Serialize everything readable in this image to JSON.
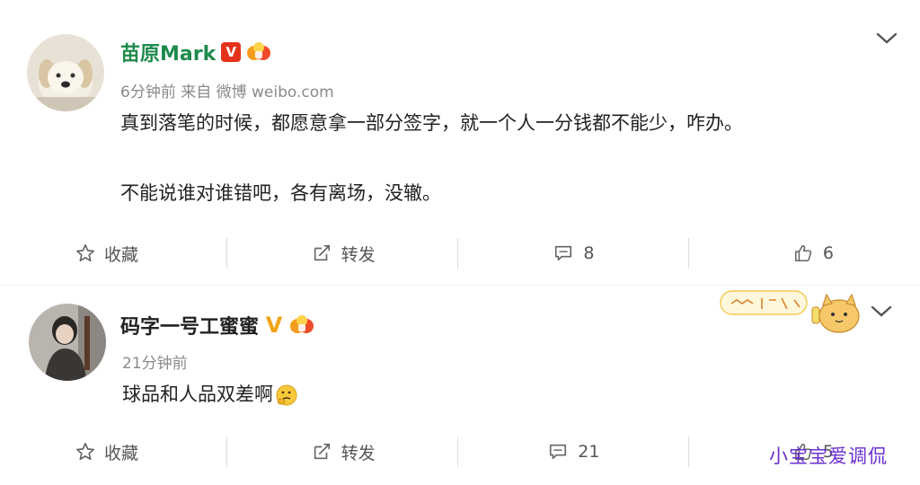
{
  "posts": [
    {
      "username": "苗原Mark",
      "verified_badge": "V",
      "meta": "6分钟前 来自 微博 weibo.com",
      "content_lines": [
        "真到落笔的时候，都愿意拿一部分签字，就一个人一分钱都不能少，咋办。",
        "不能说谁对谁错吧，各有离场，没辙。"
      ],
      "actions": {
        "favorite": "收藏",
        "repost": "转发",
        "comments": "8",
        "likes": "6"
      }
    },
    {
      "username": "码字一号工蜜蜜",
      "verified_badge": "V",
      "meta": "21分钟前",
      "content_lines": [
        "球品和人品双差啊"
      ],
      "actions": {
        "favorite": "收藏",
        "repost": "转发",
        "comments": "21",
        "likes": "5"
      }
    }
  ],
  "watermark": "小宝宝爱调侃",
  "colors": {
    "name_green": "#1f8a4c",
    "verified_red": "#e3341b",
    "verified_gold": "#f2a516",
    "watermark_purple": "#6b2fd1"
  },
  "icons": [
    "chevron-down-icon",
    "star-icon",
    "repost-icon",
    "comment-icon",
    "like-icon",
    "level-badge-icon",
    "thinking-emoji-icon",
    "cat-sticker"
  ]
}
